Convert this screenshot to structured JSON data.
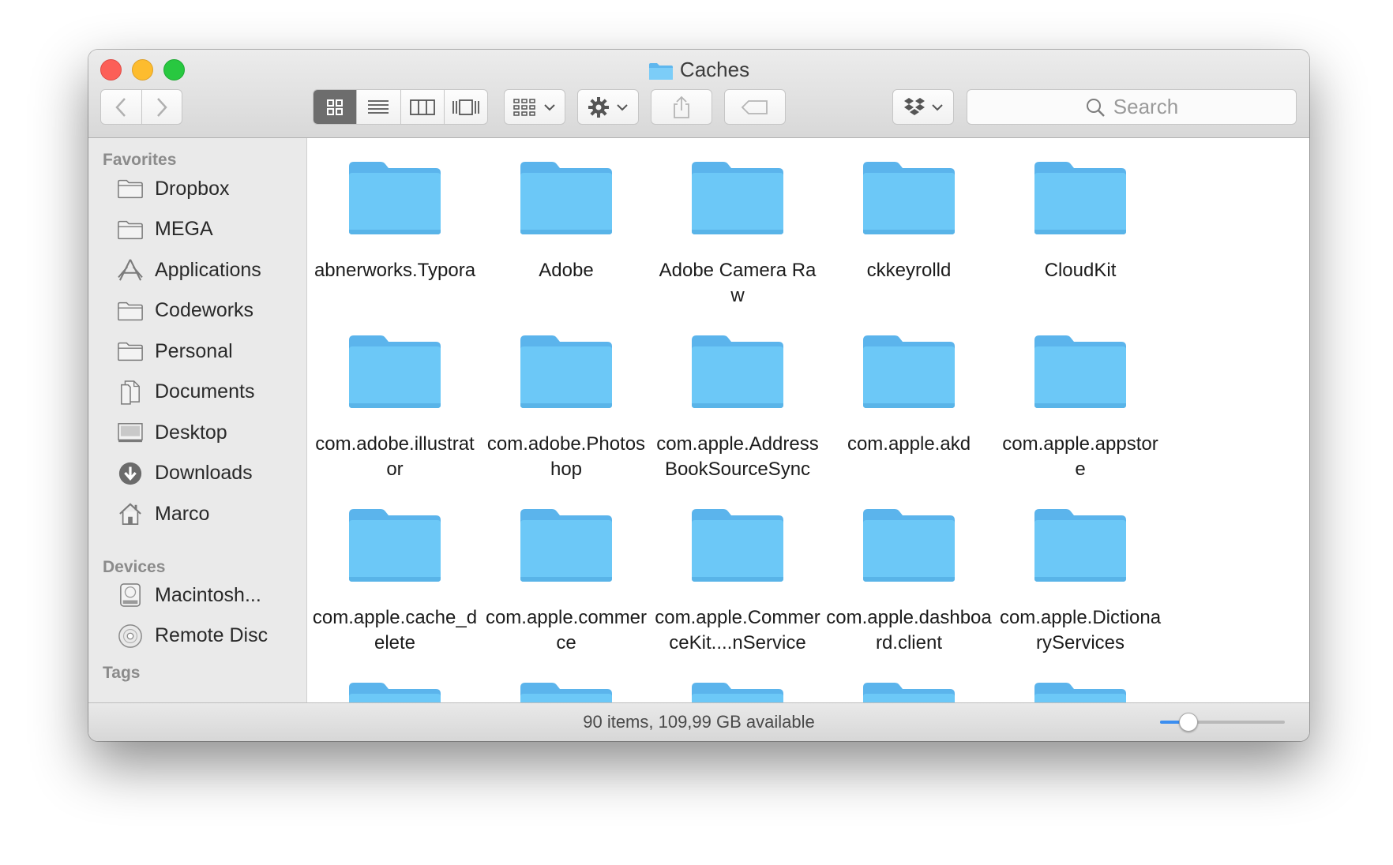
{
  "window": {
    "title": "Caches"
  },
  "toolbar": {
    "back_icon": "chevron-left-icon",
    "forward_icon": "chevron-right-icon",
    "view_modes": [
      "icon-view-icon",
      "list-view-icon",
      "column-view-icon",
      "cover-flow-icon"
    ],
    "active_view": 0,
    "arrange_icon": "arrange-grid-icon",
    "action_icon": "gear-icon",
    "share_icon": "share-icon",
    "tag_icon": "tag-icon",
    "dropbox_icon": "dropbox-icon",
    "search_placeholder": "Search"
  },
  "sidebar": {
    "favorites_heading": "Favorites",
    "favorites": [
      {
        "label": "Dropbox",
        "icon": "folder-icon"
      },
      {
        "label": "MEGA",
        "icon": "folder-icon"
      },
      {
        "label": "Applications",
        "icon": "applications-icon"
      },
      {
        "label": "Codeworks",
        "icon": "folder-icon"
      },
      {
        "label": "Personal",
        "icon": "folder-icon"
      },
      {
        "label": "Documents",
        "icon": "documents-icon"
      },
      {
        "label": "Desktop",
        "icon": "desktop-icon"
      },
      {
        "label": "Downloads",
        "icon": "download-icon"
      },
      {
        "label": "Marco",
        "icon": "home-icon"
      }
    ],
    "devices_heading": "Devices",
    "devices": [
      {
        "label": "Macintosh...",
        "icon": "hard-drive-icon"
      },
      {
        "label": "Remote Disc",
        "icon": "disc-icon"
      }
    ],
    "tags_heading": "Tags"
  },
  "content": {
    "items": [
      {
        "name": "abnerworks.Typora"
      },
      {
        "name": "Adobe"
      },
      {
        "name": "Adobe Camera Raw"
      },
      {
        "name": "ckkeyrolld"
      },
      {
        "name": "CloudKit"
      },
      {
        "name": "com.adobe.illustrator"
      },
      {
        "name": "com.adobe.Photoshop"
      },
      {
        "name": "com.apple.AddressBookSourceSync"
      },
      {
        "name": "com.apple.akd"
      },
      {
        "name": "com.apple.appstore"
      },
      {
        "name": "com.apple.cache_delete"
      },
      {
        "name": "com.apple.commerce"
      },
      {
        "name": "com.apple.CommerceKit....nService"
      },
      {
        "name": "com.apple.dashboard.client"
      },
      {
        "name": "com.apple.DictionaryServices"
      }
    ]
  },
  "status": {
    "text": "90 items, 109,99 GB available",
    "zoom_level": 0.22
  },
  "colors": {
    "folder": "#6cc8f7",
    "accent": "#3b8ef0"
  }
}
